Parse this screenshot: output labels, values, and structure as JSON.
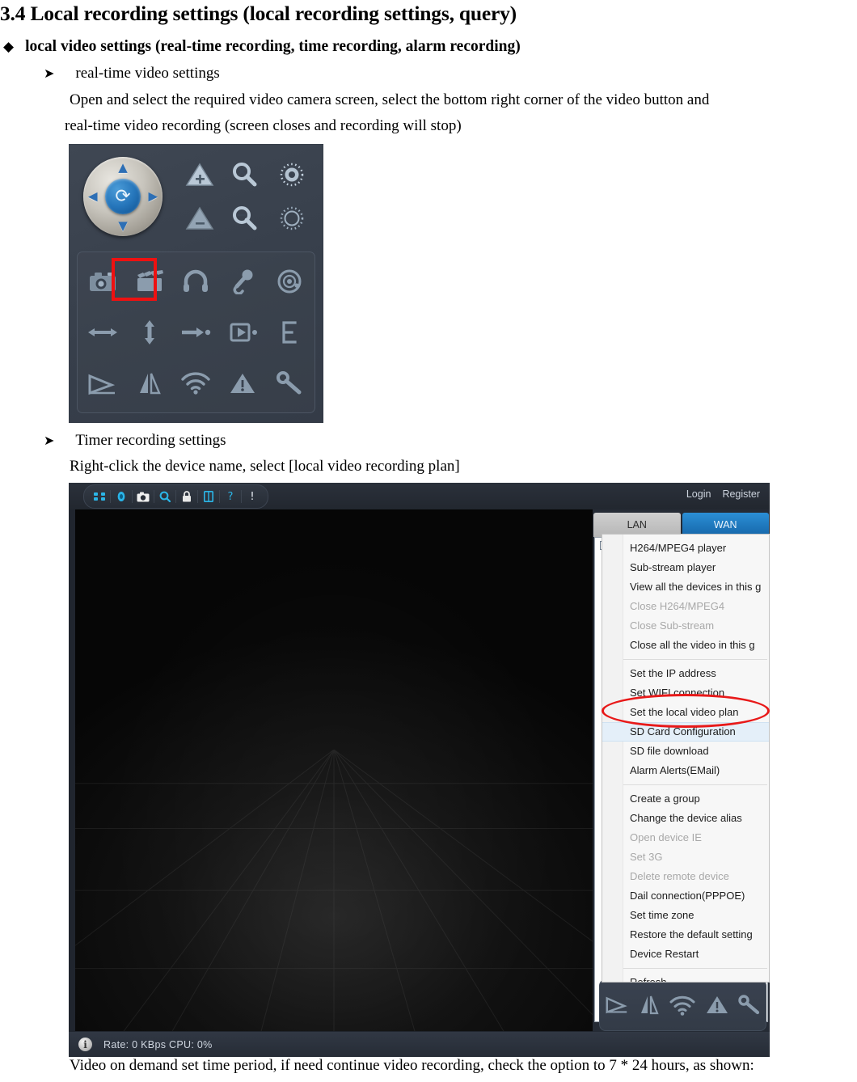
{
  "document": {
    "heading": "3.4 Local recording settings (local recording settings, query)",
    "bullet_level1": {
      "marker": "diamond-bullet",
      "text": "local video settings (real-time recording, time recording, alarm recording)"
    },
    "section_a": {
      "marker": "arrow-bullet",
      "title": "real-time video settings",
      "body_line1": "Open and select the required video camera screen, select the bottom right corner of the video button and",
      "body_line2": "real-time video recording (screen closes and recording will stop)"
    },
    "section_b": {
      "marker": "arrow-bullet",
      "title": "Timer recording settings",
      "body_line1": "Right-click the device name, select [local video recording plan]"
    },
    "footer_line": "Video on demand set time period, if need continue video recording, check the option to 7 * 24 hours, as shown:"
  },
  "control_panel": {
    "ptz": {
      "center_icon": "refresh-rotate-icon",
      "up": "arrow-up-icon",
      "down": "arrow-down-icon",
      "left": "arrow-left-icon",
      "right": "arrow-right-icon"
    },
    "side_icons": [
      {
        "name": "zoom-in-icon",
        "glyph": "▲",
        "sub": "+"
      },
      {
        "name": "zoom-out-icon",
        "glyph": "▲",
        "sub": "−"
      },
      {
        "name": "focus-near-icon",
        "glyph": "🔍",
        "sub": "✕"
      },
      {
        "name": "focus-far-icon",
        "glyph": "🔍",
        "sub": "−"
      },
      {
        "name": "iris-open-icon",
        "glyph": "◉",
        "sub": ""
      },
      {
        "name": "iris-close-icon",
        "glyph": "○",
        "sub": ""
      }
    ],
    "function_grid": [
      {
        "name": "snapshot-icon",
        "glyph": "📷"
      },
      {
        "name": "record-icon",
        "glyph": "🎬",
        "highlighted": true
      },
      {
        "name": "listen-icon",
        "glyph": "∩"
      },
      {
        "name": "talk-microphone-icon",
        "glyph": "🎤"
      },
      {
        "name": "power-icon",
        "glyph": "◎"
      },
      {
        "name": "horizontal-patrol-icon",
        "glyph": "↔"
      },
      {
        "name": "vertical-patrol-icon",
        "glyph": "↕"
      },
      {
        "name": "goto-preset-icon",
        "glyph": "→•"
      },
      {
        "name": "set-preset-icon",
        "glyph": "⇥"
      },
      {
        "name": "edge-scan-icon",
        "glyph": "⌸"
      },
      {
        "name": "play-icon",
        "glyph": "▷"
      },
      {
        "name": "mirror-flip-icon",
        "glyph": "◥"
      },
      {
        "name": "wifi-icon",
        "glyph": "📶"
      },
      {
        "name": "alarm-warning-icon",
        "glyph": "⚠"
      },
      {
        "name": "settings-wrench-icon",
        "glyph": "🔧"
      }
    ],
    "record_highlight_color": "#ee1111"
  },
  "app": {
    "toolbar_icons": [
      {
        "name": "fullscreen-grid-icon",
        "glyph": "✣"
      },
      {
        "name": "eye-view-icon",
        "glyph": "◉"
      },
      {
        "name": "camera-snapshot-icon",
        "glyph": "▣"
      },
      {
        "name": "search-icon",
        "glyph": "⌕"
      },
      {
        "name": "lock-icon",
        "glyph": "⬛"
      },
      {
        "name": "book-log-icon",
        "glyph": "▤"
      },
      {
        "name": "help-question-icon",
        "glyph": "?"
      },
      {
        "name": "alert-exclamation-icon",
        "glyph": "!"
      }
    ],
    "auth": {
      "login": "Login",
      "register": "Register"
    },
    "tabs": [
      {
        "label": "LAN",
        "active": false
      },
      {
        "label": "WAN",
        "active": true
      }
    ],
    "device_tree": {
      "selected_node_label": ""
    },
    "dock_icons": [
      {
        "name": "play-icon",
        "glyph": "▷"
      },
      {
        "name": "mirror-flip-icon",
        "glyph": "◥"
      },
      {
        "name": "wifi-icon",
        "glyph": "📶"
      },
      {
        "name": "alarm-warning-icon",
        "glyph": "⚠"
      },
      {
        "name": "settings-wrench-icon",
        "glyph": "🔧"
      }
    ],
    "statusbar": {
      "info_icon": "info-icon",
      "text": "Rate: 0 KBps  CPU:  0%"
    },
    "context_menu": {
      "items": [
        {
          "label": "H264/MPEG4 player",
          "disabled": false,
          "highlight": false
        },
        {
          "label": "Sub-stream player",
          "disabled": false,
          "highlight": false
        },
        {
          "label": "View all the devices in this g",
          "disabled": false,
          "highlight": false
        },
        {
          "label": "Close H264/MPEG4",
          "disabled": true,
          "highlight": false
        },
        {
          "label": "Close Sub-stream",
          "disabled": true,
          "highlight": false
        },
        {
          "label": "Close all the video in this g",
          "disabled": false,
          "highlight": false
        },
        {
          "separator": true
        },
        {
          "label": "Set the IP address",
          "disabled": false,
          "highlight": false
        },
        {
          "label": "Set WIFI connection",
          "disabled": false,
          "highlight": false
        },
        {
          "label": "Set the local video plan",
          "disabled": false,
          "highlight": false,
          "circled": true
        },
        {
          "label": "SD Card Configuration",
          "disabled": false,
          "highlight": true
        },
        {
          "label": "SD file download",
          "disabled": false,
          "highlight": false
        },
        {
          "label": "Alarm Alerts(EMail)",
          "disabled": false,
          "highlight": false
        },
        {
          "separator": true
        },
        {
          "label": "Create a group",
          "disabled": false,
          "highlight": false
        },
        {
          "label": "Change the device alias",
          "disabled": false,
          "highlight": false
        },
        {
          "label": "Open device IE",
          "disabled": true,
          "highlight": false
        },
        {
          "label": "Set 3G",
          "disabled": true,
          "highlight": false
        },
        {
          "label": "Delete remote device",
          "disabled": true,
          "highlight": false
        },
        {
          "label": "Dail connection(PPPOE)",
          "disabled": false,
          "highlight": false
        },
        {
          "label": "Set time zone",
          "disabled": false,
          "highlight": false
        },
        {
          "label": "Restore the default setting",
          "disabled": false,
          "highlight": false
        },
        {
          "label": "Device Restart",
          "disabled": false,
          "highlight": false
        },
        {
          "separator": true
        },
        {
          "label": "Refresh",
          "disabled": false,
          "highlight": false
        }
      ],
      "annotation_color": "#e81919"
    }
  }
}
